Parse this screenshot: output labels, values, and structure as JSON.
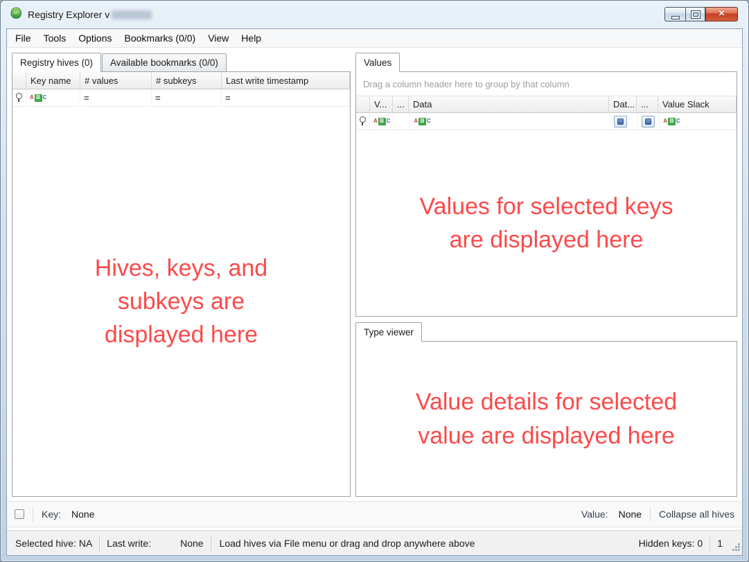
{
  "window": {
    "title": "Registry Explorer v",
    "app_icon": "registry-explorer-green-icon",
    "controls": [
      {
        "name": "minimize"
      },
      {
        "name": "maximize"
      },
      {
        "name": "close"
      }
    ]
  },
  "menu": {
    "items": [
      {
        "label": "File"
      },
      {
        "label": "Tools"
      },
      {
        "label": "Options"
      },
      {
        "label": "Bookmarks (0/0)"
      },
      {
        "label": "View"
      },
      {
        "label": "Help"
      }
    ]
  },
  "hives_pane": {
    "tabs": [
      {
        "label": "Registry hives (0)"
      },
      {
        "label": "Available bookmarks (0/0)"
      }
    ],
    "columns": [
      "Key name",
      "# values",
      "# subkeys",
      "Last write timestamp"
    ],
    "filters": {
      "values_op": "=",
      "subkeys_op": "=",
      "last_write_op": "="
    },
    "placeholder": "Hives, keys, and\nsubkeys are\ndisplayed here"
  },
  "values_pane": {
    "tab": "Values",
    "group_hint": "Drag a column header here to group by that column",
    "columns": [
      "V...",
      "...",
      "Data",
      "Dat...",
      "...",
      "Value Slack"
    ],
    "placeholder": "Values for selected keys\nare displayed here"
  },
  "type_viewer": {
    "tab": "Type viewer",
    "placeholder": "Value details for selected\nvalue are displayed here"
  },
  "key_bar": {
    "key_label": "Key:",
    "key_value": "None",
    "value_label": "Value:",
    "value_value": "None",
    "collapse_all": "Collapse all hives"
  },
  "status_bar": {
    "selected_hive": "Selected hive: NA",
    "last_write_label": "Last write:",
    "last_write_value": "None",
    "hint": "Load hives via File menu or drag and drop anywhere above",
    "hidden_keys": "Hidden keys: 0",
    "counter": "1"
  },
  "icons": {
    "abc_filter": [
      "A",
      "B",
      "C"
    ],
    "pin": "filter-row-pin",
    "date_editor": "blue-editor-button"
  },
  "colors": {
    "placeholder_red": "#fb4a4a",
    "abc_green": "#3fa646",
    "editor_blue": "#3c66a8",
    "close_red": "#c33d22",
    "app_green": "#43a047"
  }
}
